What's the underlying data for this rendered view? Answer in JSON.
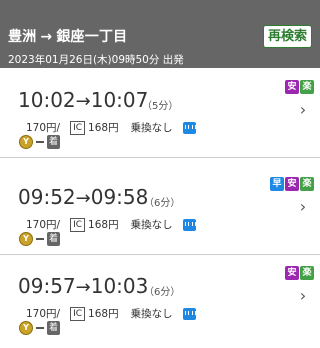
{
  "header": {
    "from": "豊洲",
    "arrow": "→",
    "to": "銀座一丁目",
    "recheck_label": "再検索",
    "datetime": "2023年01月26日(木)09時50分 出発"
  },
  "colors": {
    "header_bg": "#666666",
    "safe": "#9c27b0",
    "easy": "#43a047",
    "fast": "#1e88e5",
    "line_yurakucho": "#c9a227"
  },
  "results": [
    {
      "depart": "10:02",
      "arrow": "→",
      "arrive": "10:07",
      "duration": "（5分）",
      "fare": "170円/",
      "ic_label": "IC",
      "ic_fare": "168円",
      "transfer": "乗換なし",
      "badges": [
        {
          "label": "安",
          "color": "#9c27b0"
        },
        {
          "label": "楽",
          "color": "#43a047"
        }
      ],
      "line_letter": "Y",
      "arrive_label": "着"
    },
    {
      "depart": "09:52",
      "arrow": "→",
      "arrive": "09:58",
      "duration": "（6分）",
      "fare": "170円/",
      "ic_label": "IC",
      "ic_fare": "168円",
      "transfer": "乗換なし",
      "badges": [
        {
          "label": "早",
          "color": "#1e88e5"
        },
        {
          "label": "安",
          "color": "#9c27b0"
        },
        {
          "label": "楽",
          "color": "#43a047"
        }
      ],
      "line_letter": "Y",
      "arrive_label": "着"
    },
    {
      "depart": "09:57",
      "arrow": "→",
      "arrive": "10:03",
      "duration": "（6分）",
      "fare": "170円/",
      "ic_label": "IC",
      "ic_fare": "168円",
      "transfer": "乗換なし",
      "badges": [
        {
          "label": "安",
          "color": "#9c27b0"
        },
        {
          "label": "楽",
          "color": "#43a047"
        }
      ],
      "line_letter": "Y",
      "arrive_label": "着"
    }
  ]
}
